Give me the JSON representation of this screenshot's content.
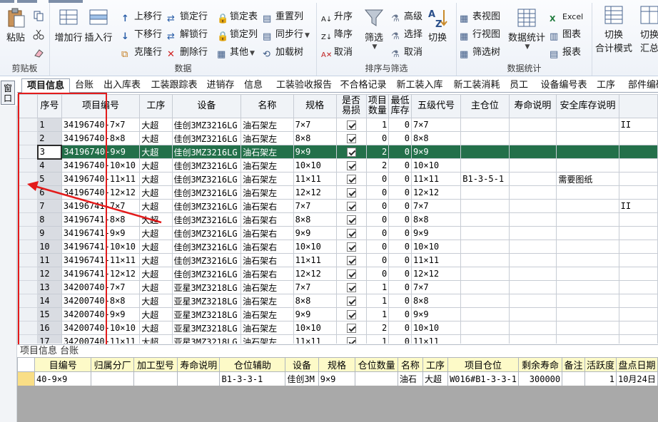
{
  "ribbon": {
    "clipboard": {
      "label": "剪贴板",
      "paste": "粘贴"
    },
    "data": {
      "label": "数据",
      "add_row": "增加行",
      "insert_row": "插入行",
      "move_up": "上移行",
      "move_down": "下移行",
      "clone_row": "克隆行",
      "lock_row": "锁定行",
      "unlock_row": "解锁行",
      "delete_row": "删除行",
      "lock_table": "锁定表",
      "lock_col": "锁定列",
      "other": "其他",
      "reset_col": "重置列",
      "sync_row": "同步行",
      "load_tree": "加载树"
    },
    "sort_filter": {
      "label": "排序与筛选",
      "asc": "升序",
      "desc": "降序",
      "cancel_sort": "取消",
      "filter": "筛选",
      "advanced": "高级",
      "select": "选择",
      "cancel_filter": "取消",
      "switch": "切换"
    },
    "stats": {
      "label": "数据统计",
      "table_view": "表视图",
      "row_view": "行视图",
      "filter_tree": "筛选树",
      "data_stats": "数据统计",
      "excel": "Excel",
      "chart": "图表",
      "report": "报表",
      "switch_total": "切换",
      "total_mode": "合计模式",
      "switch_summary": "切换",
      "summary": "汇总"
    }
  },
  "side_tab": "窗口",
  "sheet_tabs": [
    "项目信息",
    "台账",
    "出入库表",
    "工装跟踪表",
    "进销存",
    "信息",
    "工装验收报告",
    "不合格记录",
    "新工装入库",
    "新工装消耗",
    "员工",
    "设备编号表",
    "工序",
    "部件编码"
  ],
  "grid": {
    "columns": [
      "序号",
      "项目编号",
      "工序",
      "设备",
      "名称",
      "规格",
      "是否易损",
      "项目数量",
      "最低库存",
      "五级代号",
      "主仓位",
      "寿命说明",
      "安全库存说明",
      ""
    ],
    "rows": [
      [
        "1",
        "34196740-7×7",
        "大超",
        "佳创3MZ3216LG",
        "油石架左",
        "7×7",
        "✓",
        "1",
        "0",
        "7×7",
        "",
        "",
        "",
        "II"
      ],
      [
        "2",
        "34196740-8×8",
        "大超",
        "佳创3MZ3216LG",
        "油石架左",
        "8×8",
        "✓",
        "0",
        "0",
        "8×8",
        "",
        "",
        "",
        ""
      ],
      [
        "3",
        "34196740-9×9",
        "大超",
        "佳创3MZ3216LG",
        "油石架左",
        "9×9",
        "✓",
        "2",
        "0",
        "9×9",
        "",
        "",
        "",
        ""
      ],
      [
        "4",
        "34196740-10×10",
        "大超",
        "佳创3MZ3216LG",
        "油石架左",
        "10×10",
        "✓",
        "2",
        "0",
        "10×10",
        "",
        "",
        "",
        ""
      ],
      [
        "5",
        "34196740-11×11",
        "大超",
        "佳创3MZ3216LG",
        "油石架左",
        "11×11",
        "✓",
        "0",
        "0",
        "11×11",
        "B1-3-5-1",
        "",
        "需要图纸",
        ""
      ],
      [
        "6",
        "34196740-12×12",
        "大超",
        "佳创3MZ3216LG",
        "油石架左",
        "12×12",
        "✓",
        "0",
        "0",
        "12×12",
        "",
        "",
        "",
        ""
      ],
      [
        "7",
        "34196741-7×7",
        "大超",
        "佳创3MZ3216LG",
        "油石架右",
        "7×7",
        "✓",
        "0",
        "0",
        "7×7",
        "",
        "",
        "",
        "II"
      ],
      [
        "8",
        "34196741-8×8",
        "大超",
        "佳创3MZ3216LG",
        "油石架右",
        "8×8",
        "✓",
        "0",
        "0",
        "8×8",
        "",
        "",
        "",
        ""
      ],
      [
        "9",
        "34196741-9×9",
        "大超",
        "佳创3MZ3216LG",
        "油石架右",
        "9×9",
        "✓",
        "0",
        "0",
        "9×9",
        "",
        "",
        "",
        ""
      ],
      [
        "10",
        "34196741-10×10",
        "大超",
        "佳创3MZ3216LG",
        "油石架右",
        "10×10",
        "✓",
        "0",
        "0",
        "10×10",
        "",
        "",
        "",
        ""
      ],
      [
        "11",
        "34196741-11×11",
        "大超",
        "佳创3MZ3216LG",
        "油石架右",
        "11×11",
        "✓",
        "0",
        "0",
        "11×11",
        "",
        "",
        "",
        ""
      ],
      [
        "12",
        "34196741-12×12",
        "大超",
        "佳创3MZ3216LG",
        "油石架右",
        "12×12",
        "✓",
        "0",
        "0",
        "12×12",
        "",
        "",
        "",
        ""
      ],
      [
        "13",
        "34200740-7×7",
        "大超",
        "亚星3MZ3218LG",
        "油石架左",
        "7×7",
        "✓",
        "1",
        "0",
        "7×7",
        "",
        "",
        "",
        ""
      ],
      [
        "14",
        "34200740-8×8",
        "大超",
        "亚星3MZ3218LG",
        "油石架左",
        "8×8",
        "✓",
        "1",
        "0",
        "8×8",
        "",
        "",
        "",
        ""
      ],
      [
        "15",
        "34200740-9×9",
        "大超",
        "亚星3MZ3218LG",
        "油石架左",
        "9×9",
        "✓",
        "1",
        "0",
        "9×9",
        "",
        "",
        "",
        ""
      ],
      [
        "16",
        "34200740-10×10",
        "大超",
        "亚星3MZ3218LG",
        "油石架左",
        "10×10",
        "✓",
        "2",
        "0",
        "10×10",
        "",
        "",
        "",
        ""
      ],
      [
        "17",
        "34200740-11×11",
        "大超",
        "亚星3MZ3218LG",
        "油石架左",
        "11×11",
        "✓",
        "1",
        "0",
        "11×11",
        "",
        "",
        "",
        ""
      ]
    ],
    "selected_row": 2
  },
  "bottom": {
    "title": "项目信息 台账",
    "columns": [
      "目编号",
      "归属分厂",
      "加工型号",
      "寿命说明",
      "仓位辅助",
      "设备",
      "规格",
      "仓位数量",
      "名称",
      "工序",
      "项目仓位",
      "剩余寿命",
      "备注",
      "活跃度",
      "盘点日期"
    ],
    "row": [
      "40-9×9",
      "",
      "",
      "",
      "B1-3-3-1",
      "佳创3M",
      "9×9",
      "",
      "油石",
      "大超",
      "W016#B1-3-3-1",
      "300000",
      "",
      "1",
      "10月24日"
    ]
  },
  "colors": {
    "selected_row": "#23704a",
    "annotation": "#e31b1b",
    "bottom_header": "#fdfac8"
  }
}
